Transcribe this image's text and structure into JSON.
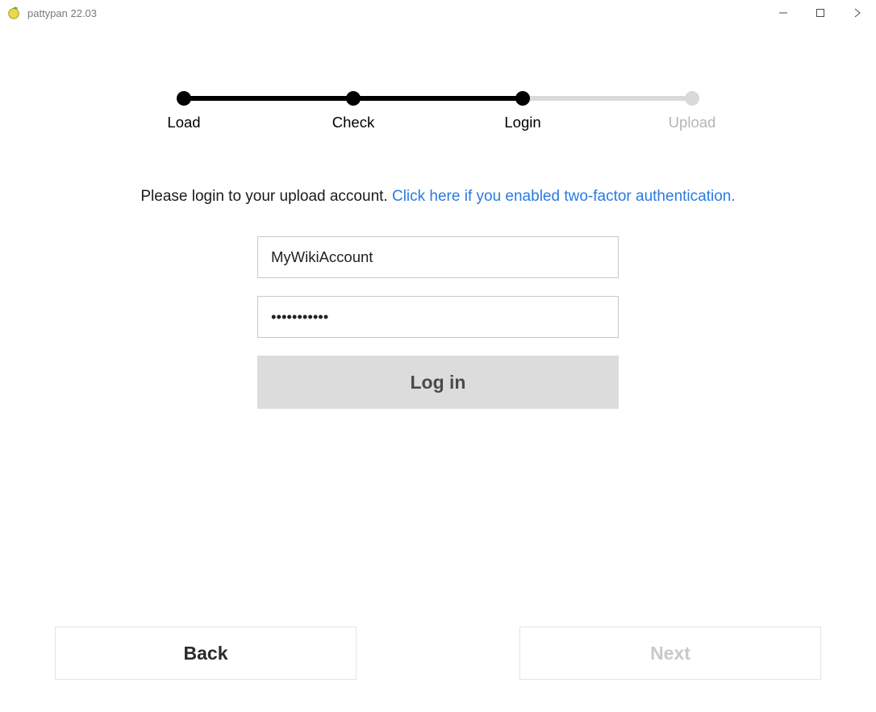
{
  "window": {
    "title": "pattypan 22.03"
  },
  "stepper": {
    "steps": [
      {
        "label": "Load",
        "state": "done"
      },
      {
        "label": "Check",
        "state": "done"
      },
      {
        "label": "Login",
        "state": "current"
      },
      {
        "label": "Upload",
        "state": "todo"
      }
    ]
  },
  "instruction": {
    "text": "Please login to your upload account. ",
    "link": "Click here if you enabled two-factor authentication."
  },
  "form": {
    "username_value": "MyWikiAccount",
    "password_value": "•••••••••••",
    "login_button": "Log in"
  },
  "nav": {
    "back": "Back",
    "next": "Next"
  }
}
